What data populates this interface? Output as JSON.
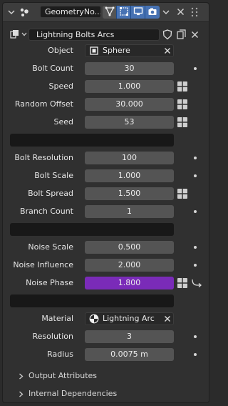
{
  "modifier": {
    "name": "GeometryNodes",
    "name_display": "GeometryNo...",
    "node_group": "Lightning Bolts Arcs"
  },
  "properties": {
    "object": {
      "label": "Object",
      "value": "Sphere"
    },
    "bolt_count": {
      "label": "Bolt Count",
      "value": "30"
    },
    "speed": {
      "label": "Speed",
      "value": "1.000"
    },
    "random_offset": {
      "label": "Random Offset",
      "value": "30.000"
    },
    "seed": {
      "label": "Seed",
      "value": "53"
    },
    "bolt_resolution": {
      "label": "Bolt Resolution",
      "value": "100"
    },
    "bolt_scale": {
      "label": "Bolt Scale",
      "value": "1.000"
    },
    "bolt_spread": {
      "label": "Bolt Spread",
      "value": "1.500"
    },
    "branch_count": {
      "label": "Branch Count",
      "value": "1"
    },
    "noise_scale": {
      "label": "Noise Scale",
      "value": "0.500"
    },
    "noise_influence": {
      "label": "Noise Influence",
      "value": "2.000"
    },
    "noise_phase": {
      "label": "Noise Phase",
      "value": "1.800"
    },
    "material": {
      "label": "Material",
      "value": "Lightning Arc"
    },
    "resolution": {
      "label": "Resolution",
      "value": "3"
    },
    "radius": {
      "label": "Radius",
      "value": "0.0075 m"
    }
  },
  "subpanels": {
    "output_attributes": "Output Attributes",
    "internal_dependencies": "Internal Dependencies"
  },
  "colors": {
    "panel_bg": "#303030",
    "field_bg": "#545454",
    "active_field": "#7a2bb8",
    "toggle_on": "#4772b3"
  }
}
